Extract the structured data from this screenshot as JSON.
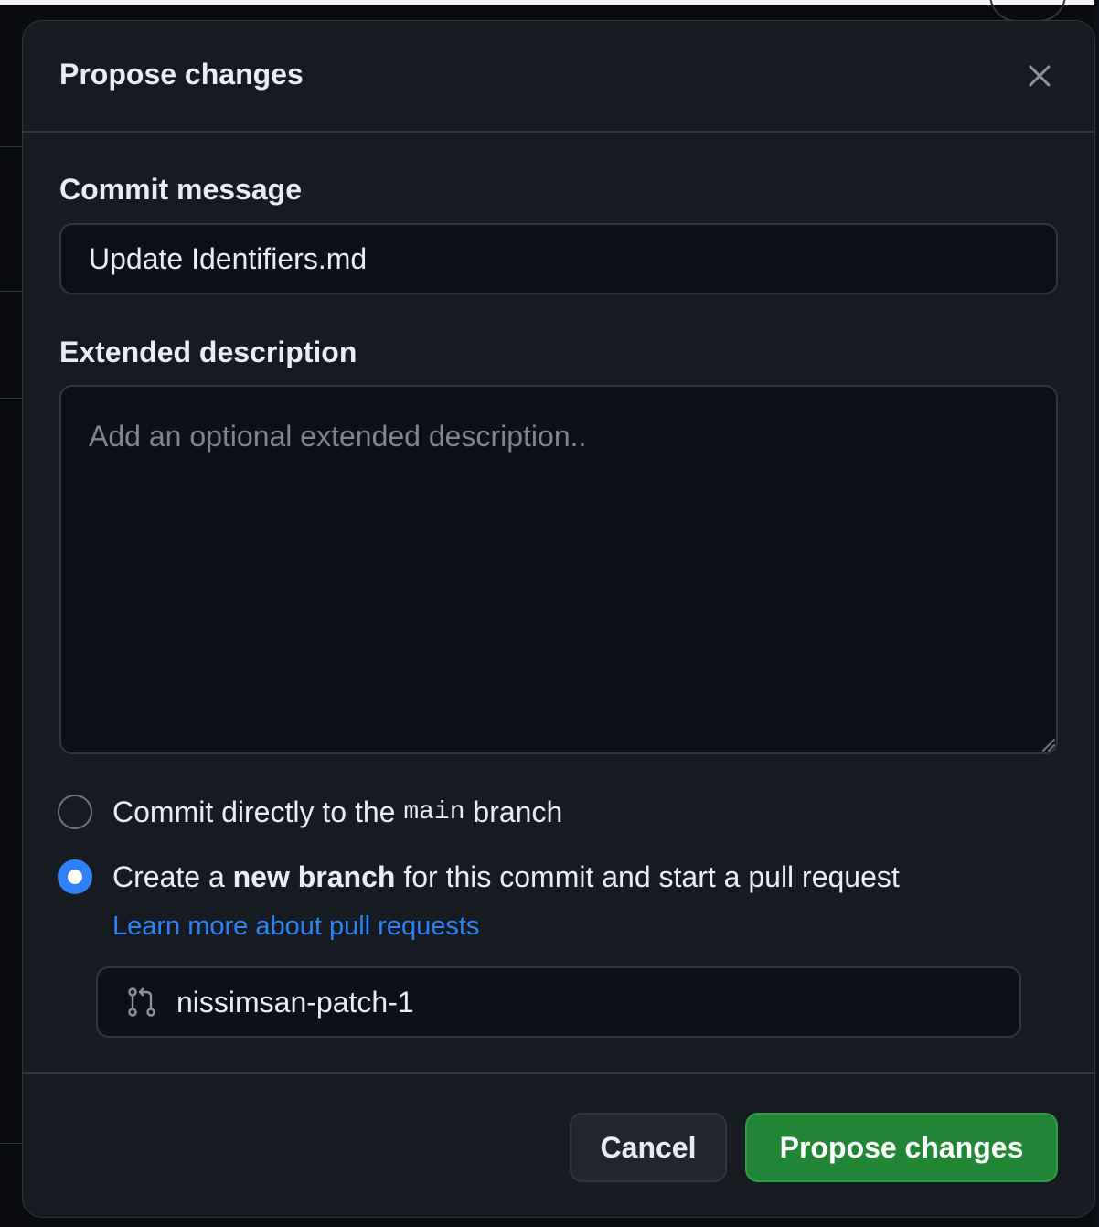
{
  "modal": {
    "title": "Propose changes",
    "close_icon": "close-icon"
  },
  "commit_message": {
    "label": "Commit message",
    "value": "Update Identifiers.md"
  },
  "extended_description": {
    "label": "Extended description",
    "placeholder": "Add an optional extended description..",
    "value": ""
  },
  "commit_options": {
    "direct": {
      "prefix": "Commit directly to the ",
      "branch_name": "main",
      "suffix": " branch",
      "selected": false
    },
    "new_branch": {
      "prefix": "Create a ",
      "emphasis": "new branch",
      "suffix": " for this commit and start a pull request",
      "selected": true
    },
    "learn_more_link": "Learn more about pull requests"
  },
  "branch": {
    "icon": "git-pull-request-icon",
    "name": "nissimsan-patch-1"
  },
  "footer": {
    "cancel_label": "Cancel",
    "submit_label": "Propose changes"
  },
  "colors": {
    "accent": "#2f81f7",
    "primary_button": "#238636",
    "modal_background": "#161b22"
  }
}
